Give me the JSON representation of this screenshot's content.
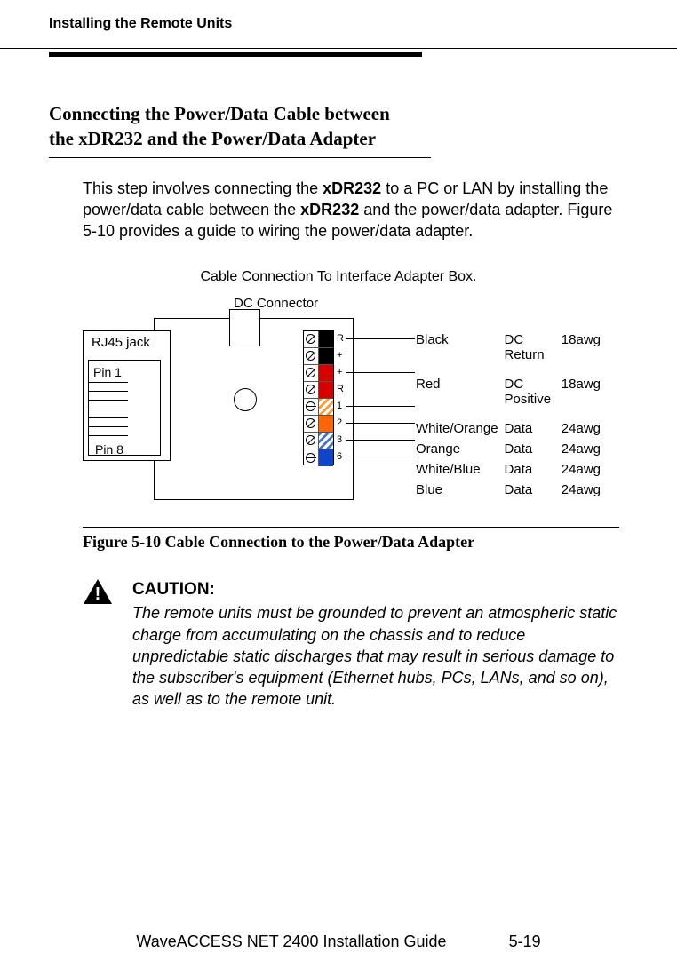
{
  "header": "Installing the Remote Units",
  "section": {
    "title_line1": "Connecting the Power/Data Cable between",
    "title_line2": "the xDR232 and the Power/Data Adapter",
    "para_pre": "This step involves connecting the ",
    "para_b1": "xDR232",
    "para_mid1": " to a PC or LAN by installing the power/data cable between the ",
    "para_b2": "xDR232",
    "para_mid2": " and the power/data adapter. Figure 5-10 provides a guide to wiring the power/data adapter."
  },
  "figure": {
    "topcaption": "Cable Connection To Interface Adapter Box.",
    "dc_connector": "DC Connector",
    "rj45": "RJ45 jack",
    "pin1": "Pin 1",
    "pin8": "Pin 8",
    "caption": "Figure 5-10  Cable Connection to the Power/Data Adapter",
    "terminal_letters": [
      "R",
      "+",
      "+",
      "R",
      "1",
      "2",
      "3",
      "6"
    ],
    "wiring": [
      {
        "color": "Black",
        "signal": "DC Return",
        "gauge": "18awg"
      },
      {
        "color": "Red",
        "signal": "DC Positive",
        "gauge": "18awg"
      },
      {
        "color": "White/Orange",
        "signal": "Data",
        "gauge": "24awg"
      },
      {
        "color": "Orange",
        "signal": "Data",
        "gauge": "24awg"
      },
      {
        "color": "White/Blue",
        "signal": "Data",
        "gauge": "24awg"
      },
      {
        "color": "Blue",
        "signal": "Data",
        "gauge": "24awg"
      }
    ]
  },
  "caution": {
    "label": "CAUTION:",
    "body": "The remote units must be grounded to prevent an atmospheric static charge from accumulating on the chassis and to reduce unpredictable static discharges that may result in serious damage to the subscriber's equipment (Ethernet hubs, PCs, LANs, and so on), as well as to the remote unit."
  },
  "footer": {
    "doc": "WaveACCESS NET 2400 Installation Guide",
    "page": "5-19"
  }
}
